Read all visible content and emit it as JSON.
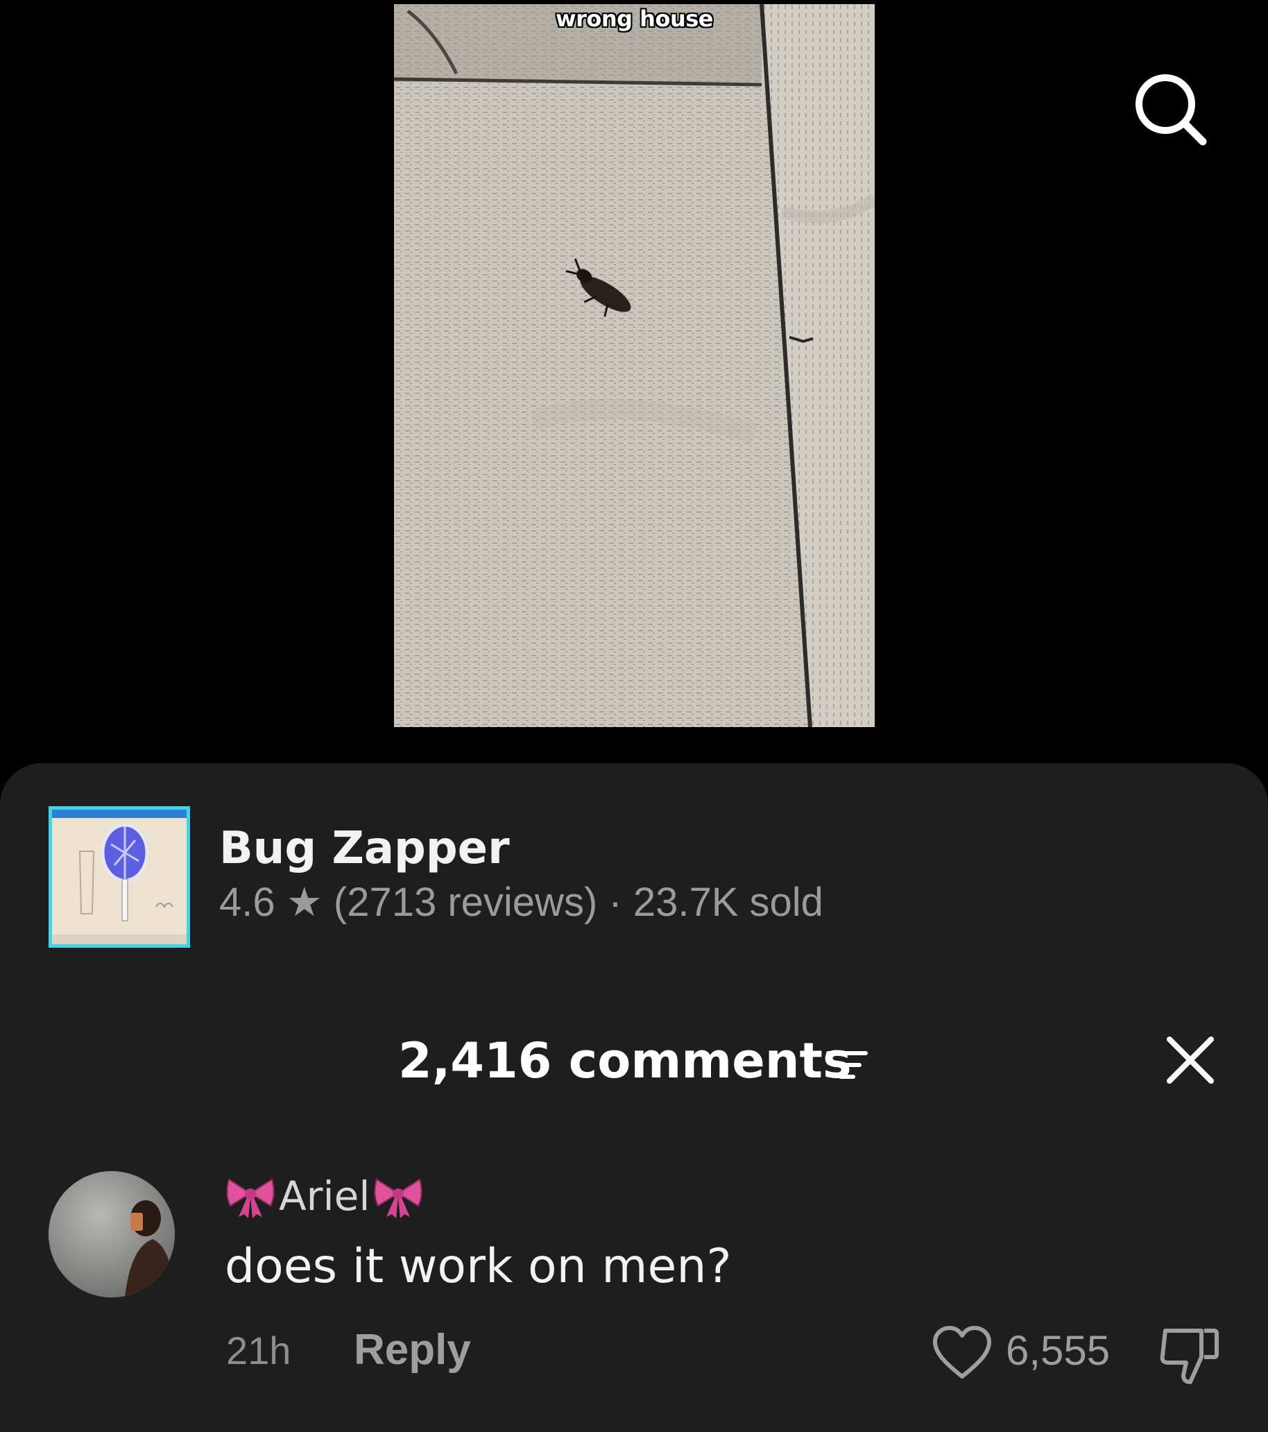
{
  "video": {
    "caption": "wrong house"
  },
  "top_bar": {
    "search_icon": "search-icon"
  },
  "product": {
    "name": "Bug Zapper",
    "rating": "4.6",
    "star": "★",
    "reviews": "(2713 reviews)",
    "separator": "·",
    "sold": "23.7K sold"
  },
  "comments": {
    "title": "2,416 comments",
    "filter_icon": "filter-icon",
    "close_icon": "close-icon",
    "items": [
      {
        "username": "Ariel",
        "username_decoration": "ribbon-bow-emoji",
        "text": "does it work on men?",
        "time": "21h",
        "reply_label": "Reply",
        "likes": "6,555"
      }
    ]
  },
  "colors": {
    "sheet_background": "#1e1e1f",
    "thumbnail_border": "#3fd6e8",
    "muted_text": "#9b9b9b",
    "bow_pink": "#e0529c"
  }
}
